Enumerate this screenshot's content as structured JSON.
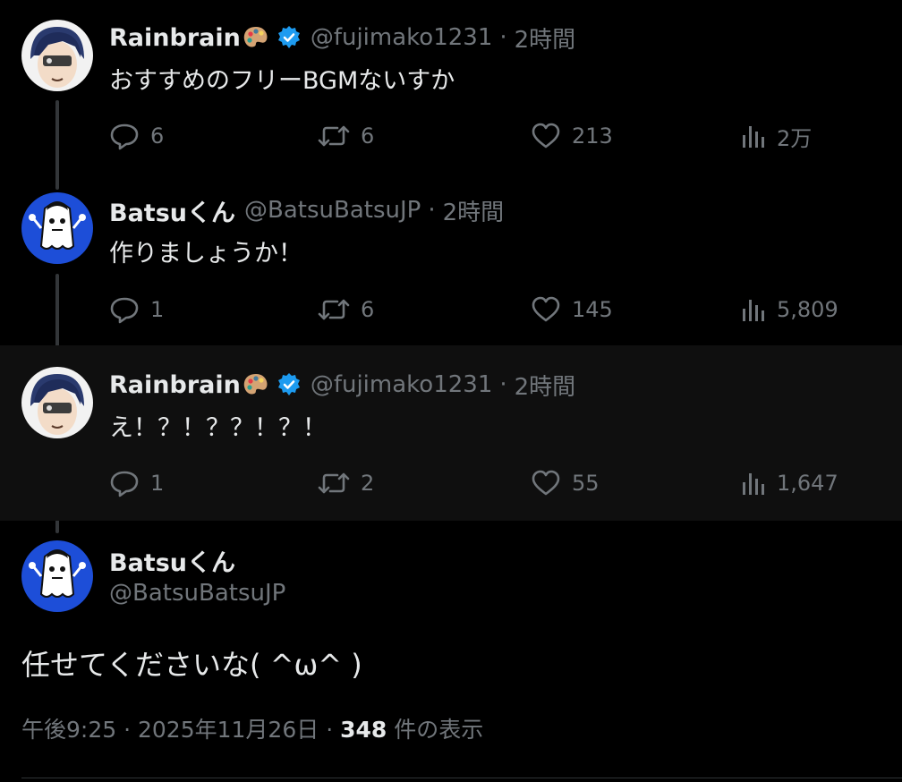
{
  "colors": {
    "background": "#000000",
    "highlight_background": "#0f0f0f",
    "primary_text": "#e7e9ea",
    "secondary_text": "#71767b",
    "verified_blue": "#1d9bf0",
    "batsu_avatar_blue": "#1d4ed8"
  },
  "replies": [
    {
      "name": "Rainbrain",
      "handle": "@fujimako1231",
      "time": "2時間",
      "verified": true,
      "name_emoji": "artist-palette-icon",
      "text": "おすすめのフリーBGMないすか",
      "stats": {
        "replies": "6",
        "reposts": "6",
        "likes": "213",
        "views": "2万"
      }
    },
    {
      "name": "Batsuくん",
      "handle": "@BatsuBatsuJP",
      "time": "2時間",
      "verified": false,
      "text": "作りましょうか！",
      "stats": {
        "replies": "1",
        "reposts": "6",
        "likes": "145",
        "views": "5,809"
      }
    },
    {
      "name": "Rainbrain",
      "handle": "@fujimako1231",
      "time": "2時間",
      "verified": true,
      "name_emoji": "artist-palette-icon",
      "text": "え！？！？？！？！",
      "stats": {
        "replies": "1",
        "reposts": "2",
        "likes": "55",
        "views": "1,647"
      }
    }
  ],
  "main_tweet": {
    "name": "Batsuくん",
    "handle": "@BatsuBatsuJP",
    "text": "任せてくださいな( ^ω^ )",
    "time": "午後9:25",
    "date": "2025年11月26日",
    "separator": "·",
    "views_count": "348",
    "views_label": "件の表示"
  },
  "separator": "·"
}
